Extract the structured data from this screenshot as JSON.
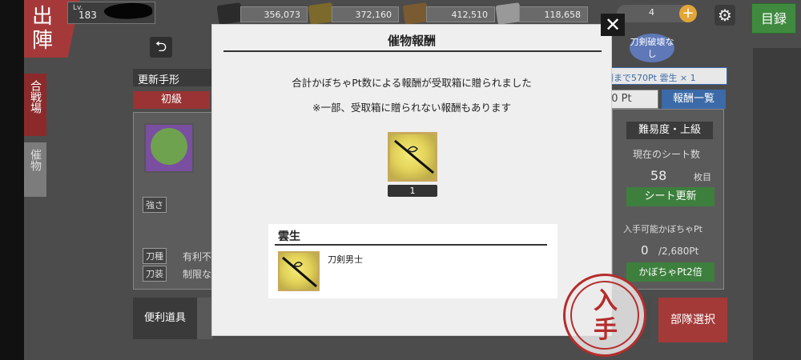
{
  "header": {
    "shutsujin": "出陣",
    "level_prefix": "Lv.",
    "level": "183",
    "resources": [
      "356,073",
      "372,160",
      "412,510",
      "118,658"
    ],
    "gold_count": "4",
    "mokuroku": "目録",
    "katana_badge": "刀剣破壊なし"
  },
  "sidebar": {
    "battle": "合戦場",
    "offering": "催物"
  },
  "left_panel": {
    "back": "⮌",
    "update_label": "更新手形",
    "difficulty_tab": "初級",
    "strength_tag": "強さ",
    "katana_type_tag": "刀種",
    "equipment_tag": "刀装",
    "katana_type_value": "有利不",
    "equipment_value": "制限な",
    "tool_label": "便利道具"
  },
  "right_panel": {
    "reward_next": "酬まで570Pt 雲生 × 1",
    "pt_input": "80 Pt",
    "reward_list_button": "報酬一覧",
    "difficulty": "難易度・上級",
    "sheet_label": "現在のシート数",
    "sheet_count": "58",
    "sheet_unit": "枚目",
    "sheet_update": "シート更新",
    "obtainable_label": "入手可能かぼちゃPt",
    "pt_current": "0",
    "pt_max": "/2,680Pt",
    "pt_double": "かぼちゃPt2倍",
    "squad_select": "部隊選択"
  },
  "modal": {
    "title": "催物報酬",
    "line1": "合計かぼちゃPt数による報酬が受取箱に贈られました",
    "line2": "※一部、受取箱に贈られない報酬もあります",
    "item_quantity": "1",
    "list_heading": "雲生",
    "list_item_label": "刀剣男士",
    "close": "✕"
  },
  "stamp_text": "入手"
}
